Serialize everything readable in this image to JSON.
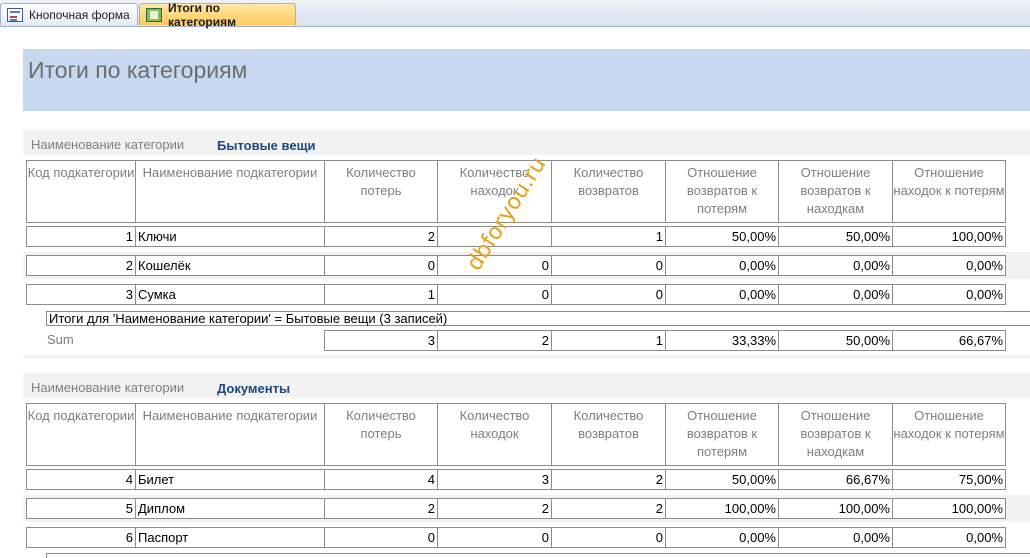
{
  "tabs": [
    {
      "label": "Кнопочная форма",
      "icon": "form-icon",
      "active": false
    },
    {
      "label": "Итоги по категориям",
      "icon": "report-icon",
      "active": true
    }
  ],
  "report": {
    "title": "Итоги по категориям",
    "watermark": "dbforyou.ru",
    "columns": [
      "Код подкатегории",
      "Наименование подкатегории",
      "Количество потерь",
      "Количество находок",
      "Количество возвратов",
      "Отношение возвратов к потерям",
      "Отношение возвратов к находкам",
      "Отношение находок к потерям"
    ],
    "groups": [
      {
        "label": "Наименование категории",
        "name": "Бытовые вещи",
        "rows": [
          [
            "1",
            "Ключи",
            "2",
            "",
            "1",
            "50,00%",
            "50,00%",
            "100,00%"
          ],
          [
            "2",
            "Кошелёк",
            "0",
            "0",
            "0",
            "0,00%",
            "0,00%",
            "0,00%"
          ],
          [
            "3",
            "Сумка",
            "1",
            "0",
            "0",
            "0,00%",
            "0,00%",
            "0,00%"
          ]
        ],
        "summary_text": "Итоги для 'Наименование категории' =  Бытовые вещи (3 записей)",
        "sum_label": "Sum",
        "sums": [
          "3",
          "2",
          "1",
          "33,33%",
          "50,00%",
          "66,67%"
        ]
      },
      {
        "label": "Наименование категории",
        "name": "Документы",
        "rows": [
          [
            "4",
            "Билет",
            "4",
            "3",
            "2",
            "50,00%",
            "66,67%",
            "75,00%"
          ],
          [
            "5",
            "Диплом",
            "2",
            "2",
            "2",
            "100,00%",
            "100,00%",
            "100,00%"
          ],
          [
            "6",
            "Паспорт",
            "0",
            "0",
            "0",
            "0,00%",
            "0,00%",
            "0,00%"
          ]
        ]
      }
    ]
  },
  "colors": {
    "header_band": "#c6d9f1",
    "group_value": "#1f497d",
    "active_tab": "#ffc95e",
    "watermark": "#e3a21a"
  }
}
